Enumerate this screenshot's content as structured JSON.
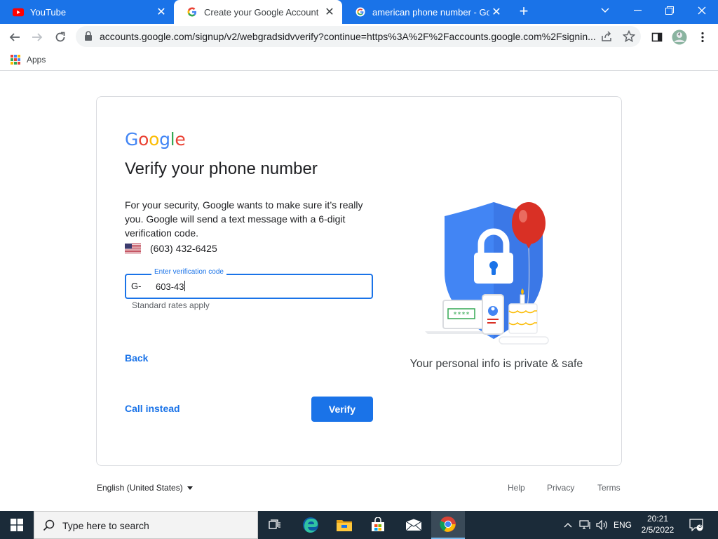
{
  "browser": {
    "tabs": [
      {
        "title": "YouTube",
        "icon": "youtube-icon",
        "active": false
      },
      {
        "title": "Create your Google Account",
        "icon": "google-g-icon",
        "active": true
      },
      {
        "title": "american phone number - Goog",
        "icon": "google-g-icon",
        "active": false
      }
    ],
    "url": "accounts.google.com/signup/v2/webgradsidvverify?continue=https%3A%2F%2Faccounts.google.com%2Fsignin...",
    "bookmarks": {
      "apps_label": "Apps"
    },
    "colors": {
      "tab_strip": "#1a73e8"
    }
  },
  "page": {
    "logo": {
      "text": "Google",
      "letters": [
        "G",
        "o",
        "o",
        "g",
        "l",
        "e"
      ],
      "colors": [
        "#4285F4",
        "#EA4335",
        "#FBBC05",
        "#4285F4",
        "#34A853",
        "#EA4335"
      ]
    },
    "heading": "Verify your phone number",
    "description": "For your security, Google wants to make sure it’s really you. Google will send a text message with a 6-digit verification code.",
    "phone": {
      "country": "United States",
      "number": "(603) 432-6425"
    },
    "code_field": {
      "label": "Enter verification code",
      "prefix": "G-",
      "value": "603-43"
    },
    "hint": "Standard rates apply",
    "back_label": "Back",
    "call_instead_label": "Call instead",
    "verify_label": "Verify",
    "illustration_caption": "Your personal info is private & safe",
    "illustration_screen_text": "****",
    "colors": {
      "primary": "#1a73e8",
      "balloon": "#d93025",
      "shield": "#4285f4"
    }
  },
  "footer": {
    "language": "English (United States)",
    "links": [
      "Help",
      "Privacy",
      "Terms"
    ]
  },
  "taskbar": {
    "search_placeholder": "Type here to search",
    "apps": [
      "task-view-icon",
      "edge-icon",
      "file-explorer-icon",
      "store-icon",
      "mail-icon",
      "chrome-icon"
    ],
    "language": "ENG",
    "time": "20:21",
    "date": "2/5/2022",
    "notification_count": "3"
  }
}
